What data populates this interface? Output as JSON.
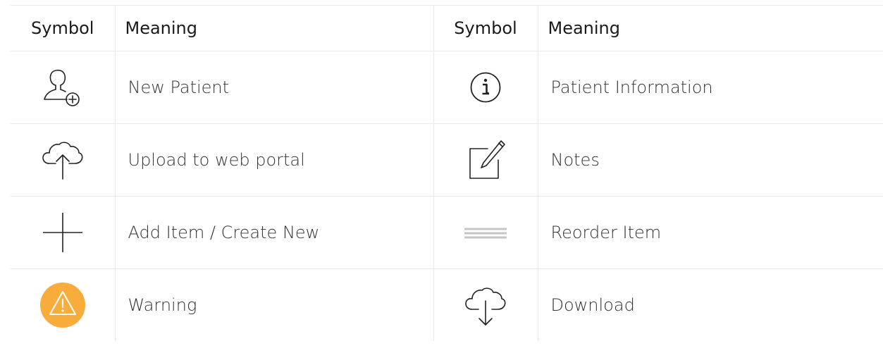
{
  "header": {
    "symbol_label_left": "Symbol",
    "meaning_label_left": "Meaning",
    "symbol_label_right": "Symbol",
    "meaning_label_right": "Meaning"
  },
  "rows": [
    {
      "left": {
        "icon": "new-patient-icon",
        "meaning": "New Patient"
      },
      "right": {
        "icon": "info-icon",
        "meaning": "Patient Information"
      }
    },
    {
      "left": {
        "icon": "cloud-upload-icon",
        "meaning": "Upload to web portal"
      },
      "right": {
        "icon": "notes-edit-icon",
        "meaning": "Notes"
      }
    },
    {
      "left": {
        "icon": "plus-icon",
        "meaning": "Add Item / Create New"
      },
      "right": {
        "icon": "reorder-handle-icon",
        "meaning": "Reorder Item"
      }
    },
    {
      "left": {
        "icon": "warning-icon",
        "meaning": "Warning"
      },
      "right": {
        "icon": "cloud-download-icon",
        "meaning": "Download"
      }
    }
  ],
  "colors": {
    "warning": "#f8ac3b",
    "reorder_handle": "#c6c6c6",
    "border": "#e9e9e9",
    "icon_stroke": "#222222"
  }
}
